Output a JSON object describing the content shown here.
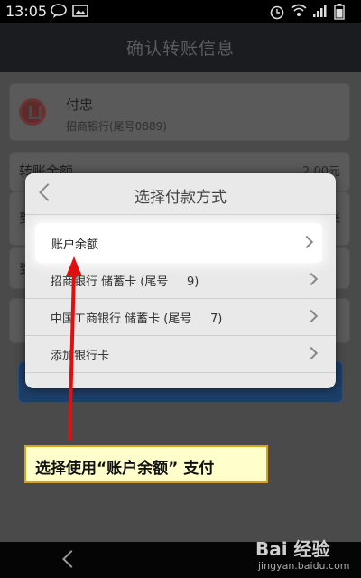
{
  "status_bar": {
    "time": "13:05"
  },
  "app_bar": {
    "title": "确认转账信息"
  },
  "payee": {
    "name": "付忠",
    "bank": "招商银行(尾号0889)"
  },
  "amount": {
    "label": "转账金额",
    "value": "2.00元"
  },
  "background_stubs": {
    "row2": "到",
    "row2_right": "账",
    "row3": "到"
  },
  "dialog": {
    "title": "选择付款方式",
    "options": [
      {
        "label": "账户余额"
      },
      {
        "label": "招商银行 储蓄卡 (尾号     9)"
      },
      {
        "label": "中国工商银行 储蓄卡 (尾号     7)"
      },
      {
        "label": "添加银行卡"
      }
    ]
  },
  "annotation": {
    "text": "选择使用“账户余额” 支付"
  },
  "watermark": {
    "logo": "Bai 经验",
    "url": "jingyan.baidu.com"
  },
  "colors": {
    "arrow": "#e01010",
    "callout_bg": "#ffffcc",
    "callout_border": "#d9a21b"
  }
}
